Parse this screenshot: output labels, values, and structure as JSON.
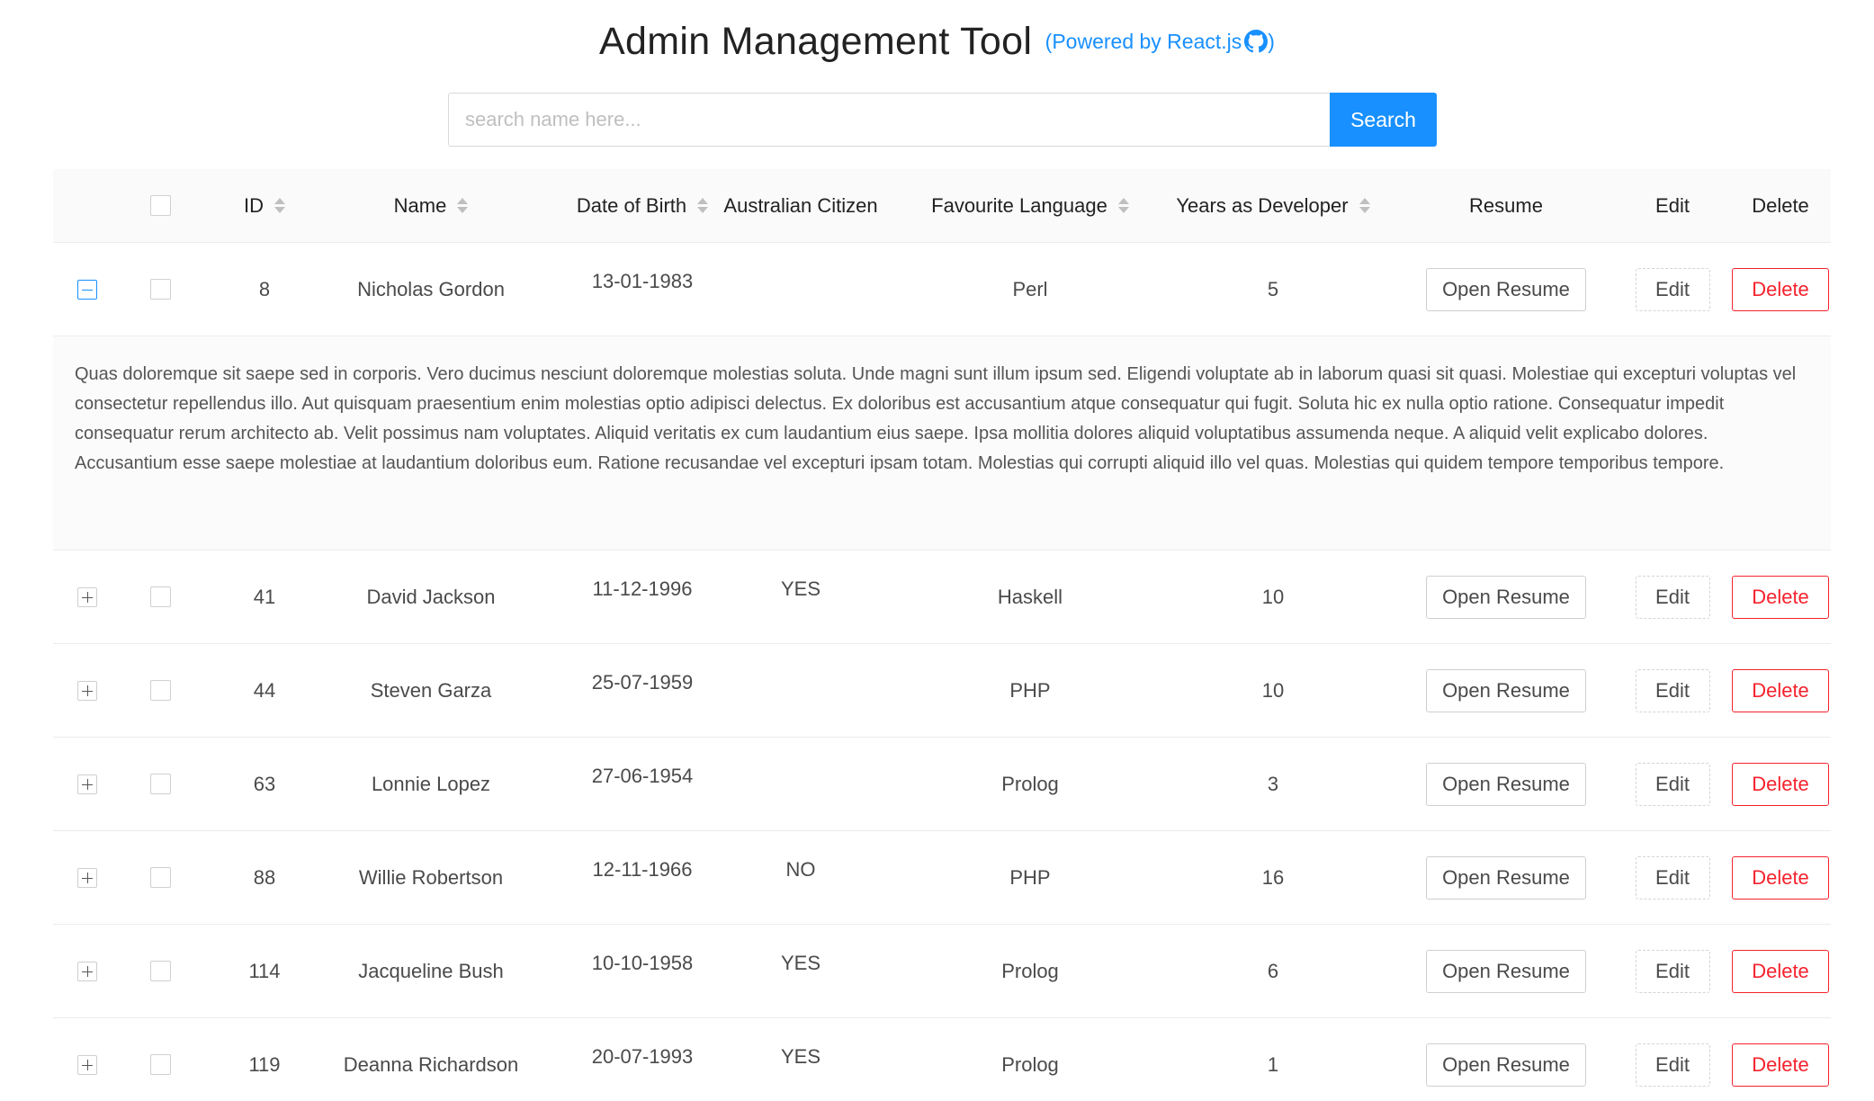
{
  "header": {
    "title": "Admin Management Tool",
    "powered_prefix": "(Powered by React.js",
    "powered_suffix": ")",
    "github_icon": "github-icon"
  },
  "search": {
    "placeholder": "search name here...",
    "value": "",
    "button_label": "Search"
  },
  "table": {
    "columns": {
      "id": "ID",
      "name": "Name",
      "dob": "Date of Birth",
      "citizen": "Australian Citizen",
      "language": "Favourite Language",
      "years": "Years as Developer",
      "resume": "Resume",
      "edit": "Edit",
      "delete": "Delete"
    },
    "buttons": {
      "resume": "Open Resume",
      "edit": "Edit",
      "delete": "Delete"
    },
    "rows": [
      {
        "id": "8",
        "name": "Nicholas Gordon",
        "dob": "13-01-1983",
        "citizen": "",
        "language": "Perl",
        "years": "5",
        "expanded": true
      },
      {
        "id": "41",
        "name": "David Jackson",
        "dob": "11-12-1996",
        "citizen": "YES",
        "language": "Haskell",
        "years": "10",
        "expanded": false
      },
      {
        "id": "44",
        "name": "Steven Garza",
        "dob": "25-07-1959",
        "citizen": "",
        "language": "PHP",
        "years": "10",
        "expanded": false
      },
      {
        "id": "63",
        "name": "Lonnie Lopez",
        "dob": "27-06-1954",
        "citizen": "",
        "language": "Prolog",
        "years": "3",
        "expanded": false
      },
      {
        "id": "88",
        "name": "Willie Robertson",
        "dob": "12-11-1966",
        "citizen": "NO",
        "language": "PHP",
        "years": "16",
        "expanded": false
      },
      {
        "id": "114",
        "name": "Jacqueline Bush",
        "dob": "10-10-1958",
        "citizen": "YES",
        "language": "Prolog",
        "years": "6",
        "expanded": false
      },
      {
        "id": "119",
        "name": "Deanna Richardson",
        "dob": "20-07-1993",
        "citizen": "YES",
        "language": "Prolog",
        "years": "1",
        "expanded": false
      }
    ],
    "expanded_text": "Quas doloremque sit saepe sed in corporis. Vero ducimus nesciunt doloremque molestias soluta. Unde magni sunt illum ipsum sed. Eligendi voluptate ab in laborum quasi sit quasi. Molestiae qui excepturi voluptas vel consectetur repellendus illo. Aut quisquam praesentium enim molestias optio adipisci delectus. Ex doloribus est accusantium atque consequatur qui fugit. Soluta hic ex nulla optio ratione. Consequatur impedit consequatur rerum architecto ab. Velit possimus nam voluptates. Aliquid veritatis ex cum laudantium eius saepe. Ipsa mollitia dolores aliquid voluptatibus assumenda neque. A aliquid velit explicabo dolores. Accusantium esse saepe molestiae at laudantium doloribus eum. Ratione recusandae vel excepturi ipsam totam. Molestias qui corrupti aliquid illo vel quas. Molestias qui quidem tempore temporibus tempore."
  },
  "colors": {
    "accent": "#1890ff",
    "danger": "#f5222d",
    "header_bg": "#fafafa"
  }
}
